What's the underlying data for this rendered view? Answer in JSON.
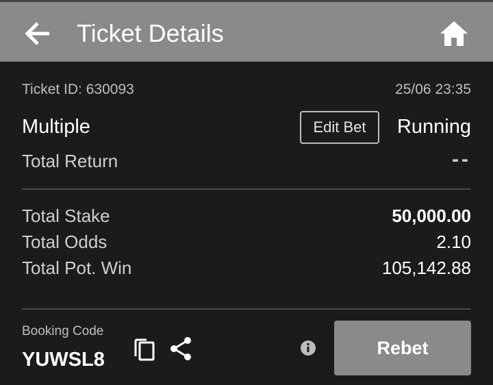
{
  "header": {
    "title": "Ticket Details",
    "back_icon": "arrow-back-icon",
    "home_icon": "home-icon",
    "background": "#8a8a8a"
  },
  "ticket": {
    "id_label": "Ticket ID: 630093",
    "datetime": "25/06 23:35",
    "bet_type": "Multiple",
    "edit_button": "Edit Bet",
    "status": "Running",
    "total_return_label": "Total Return",
    "total_return_value": "--"
  },
  "totals": {
    "stake_label": "Total Stake",
    "stake_value": "50,000.00",
    "odds_label": "Total Odds",
    "odds_value": "2.10",
    "pot_win_label": "Total Pot. Win",
    "pot_win_value": "105,142.88"
  },
  "booking": {
    "label": "Booking Code",
    "code": "YUWSL8",
    "copy_icon": "copy-icon",
    "share_icon": "share-icon",
    "info_icon": "info-icon",
    "rebet_label": "Rebet"
  }
}
